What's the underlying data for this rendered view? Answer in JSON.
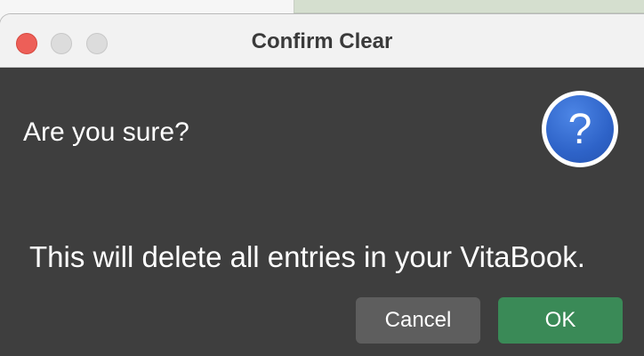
{
  "window": {
    "title": "Confirm Clear"
  },
  "dialog": {
    "question": "Are you sure?",
    "message": "This will delete all entries in your VitaBook.",
    "icon": "question-icon",
    "icon_glyph": "?"
  },
  "buttons": {
    "cancel_label": "Cancel",
    "ok_label": "OK"
  },
  "colors": {
    "body_background": "#3e3e3e",
    "ok_button": "#3a8a57",
    "cancel_button": "#5e5e5e",
    "icon_blue": "#2e63c8",
    "close_button": "#ed5f58"
  }
}
